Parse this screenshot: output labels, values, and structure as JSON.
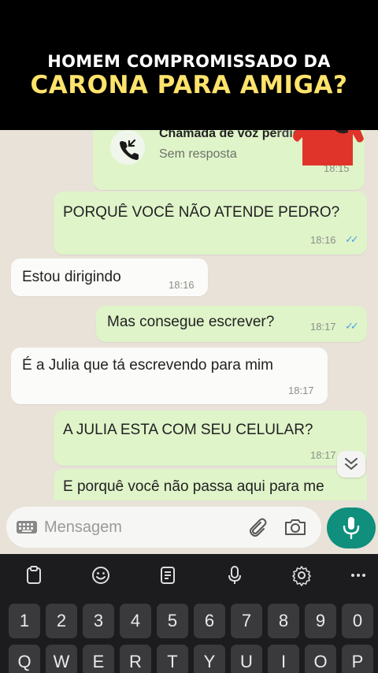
{
  "banner": {
    "line1": "HOMEM COMPROMISSADO DA",
    "line2": "CARONA PARA AMIGA?"
  },
  "call": {
    "title": "Chamada de voz pe",
    "title_tail": "rdida",
    "status": "Sem resposta",
    "time": "18:15"
  },
  "messages": [
    {
      "direction": "out",
      "text": "PORQUÊ VOCÊ NÃO ATENDE PEDRO?",
      "time": "18:16",
      "read": true
    },
    {
      "direction": "in",
      "text": "Estou dirigindo",
      "time": "18:16"
    },
    {
      "direction": "out",
      "text": "Mas consegue escrever?",
      "time": "18:17",
      "read": true
    },
    {
      "direction": "in",
      "text": "É a Julia que tá escrevendo para mim",
      "time": "18:17"
    },
    {
      "direction": "out",
      "text": "A JULIA ESTA COM SEU CELULAR?",
      "time": "18:17"
    },
    {
      "direction": "out",
      "text": "E porquê você não passa aqui para me"
    }
  ],
  "composer": {
    "placeholder": "Mensagem"
  },
  "keyboard": {
    "number_row": [
      "1",
      "2",
      "3",
      "4",
      "5",
      "6",
      "7",
      "8",
      "9",
      "0"
    ],
    "letter_row": [
      "Q",
      "W",
      "E",
      "R",
      "T",
      "Y",
      "U",
      "I",
      "O",
      "P"
    ]
  },
  "colors": {
    "outgoing_bubble": "#dff4c9",
    "incoming_bubble": "#fbfbf9",
    "chat_background": "#e8e2d8",
    "accent_green": "#0f8f7c",
    "banner_highlight": "#ffe36b",
    "read_ticks": "#4aa2e4"
  },
  "icons": {
    "call": "missed-call-icon",
    "keyboard": "keyboard-icon",
    "attach": "paperclip-icon",
    "camera": "camera-icon",
    "mic": "microphone-icon",
    "scroll": "double-chevron-down-icon"
  }
}
